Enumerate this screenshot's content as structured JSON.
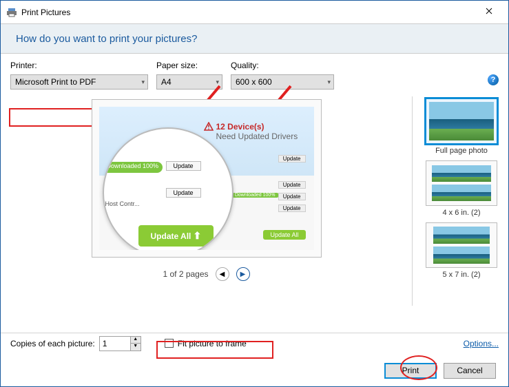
{
  "window": {
    "title": "Print Pictures",
    "header_question": "How do you want to print your pictures?"
  },
  "controls": {
    "printer": {
      "label": "Printer:",
      "value": "Microsoft Print to PDF"
    },
    "paper_size": {
      "label": "Paper size:",
      "value": "A4"
    },
    "quality": {
      "label": "Quality:",
      "value": "600 x 600"
    }
  },
  "preview": {
    "downloaded_pill": "Downloaded 100%",
    "update_btn": "Update",
    "update_all": "Update All",
    "dev_title": "12 Device(s)",
    "dev_sub": "Need Updated Drivers",
    "host": "Host Contr...",
    "mini_downloaded": "Downloaded 100%",
    "page_status": "1 of 2 pages"
  },
  "layouts": {
    "full": "Full page photo",
    "four_by_six": "4 x 6 in. (2)",
    "five_by_seven": "5 x 7 in. (2)"
  },
  "bottom": {
    "copies_label": "Copies of each picture:",
    "copies_value": "1",
    "fit_label": "Fit picture to frame",
    "options_link": "Options..."
  },
  "buttons": {
    "print": "Print",
    "cancel": "Cancel"
  }
}
